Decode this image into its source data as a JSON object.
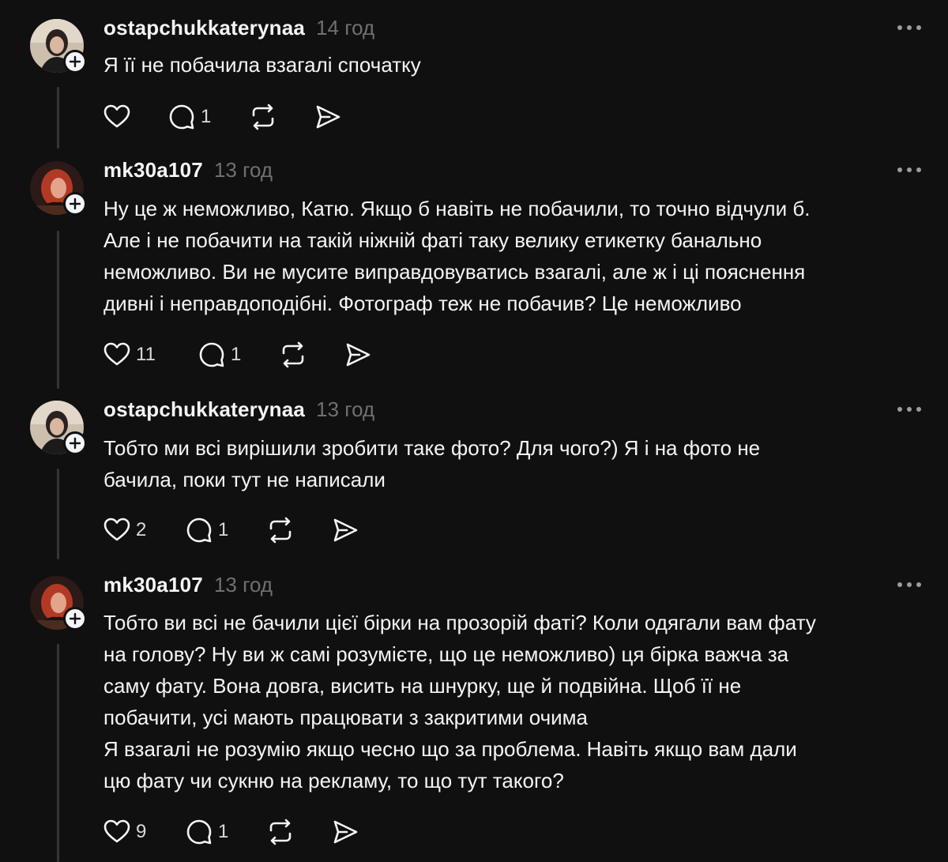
{
  "posts": [
    {
      "username": "ostapchukkaterynaa",
      "time": "14 год",
      "avatar": "avatar-woman-dark-hair",
      "lines": [
        "Я її не побачила взагалі спочатку"
      ],
      "likes": "",
      "replies": "1"
    },
    {
      "username": "mk30a107",
      "time": "13 год",
      "avatar": "avatar-woman-red-hair",
      "lines": [
        "Ну це ж неможливо, Катю. Якщо б навіть не побачили, то точно відчули б.",
        "Але і не побачити на такій ніжній фаті таку велику етикетку банально",
        "неможливо. Ви не мусите виправдовуватись взагалі, але ж і ці пояснення",
        "дивні і неправдоподібні. Фотограф теж не побачив? Це неможливо"
      ],
      "likes": "11",
      "replies": "1"
    },
    {
      "username": "ostapchukkaterynaa",
      "time": "13 год",
      "avatar": "avatar-woman-dark-hair",
      "lines": [
        "Тобто ми всі вирішили зробити таке фото? Для чого?) Я і на фото не",
        "бачила, поки тут не написали"
      ],
      "likes": "2",
      "replies": "1"
    },
    {
      "username": "mk30a107",
      "time": "13 год",
      "avatar": "avatar-woman-red-hair",
      "lines": [
        "Тобто ви всі не бачили цієї бірки на прозорій фаті? Коли одягали вам фату",
        "на голову? Ну ви ж самі розумієте, що це неможливо) ця бірка важча за",
        "саму фату. Вона довга, висить на шнурку, ще й подвійна. Щоб її не",
        "побачити, усі мають працювати з закритими очима",
        "Я взагалі не розумію якщо чесно що за проблема. Навіть якщо вам дали",
        "цю фату чи сукню на рекламу, то що тут такого?"
      ],
      "likes": "9",
      "replies": "1"
    }
  ],
  "icons": {
    "like": "heart-icon",
    "reply": "comment-icon",
    "repost": "repost-icon",
    "share": "share-icon",
    "more": "more-icon",
    "follow": "plus-icon"
  },
  "colors": {
    "background": "#101010",
    "text": "#f3f5f7",
    "secondary": "#6e7073",
    "thread_line": "#333638"
  }
}
